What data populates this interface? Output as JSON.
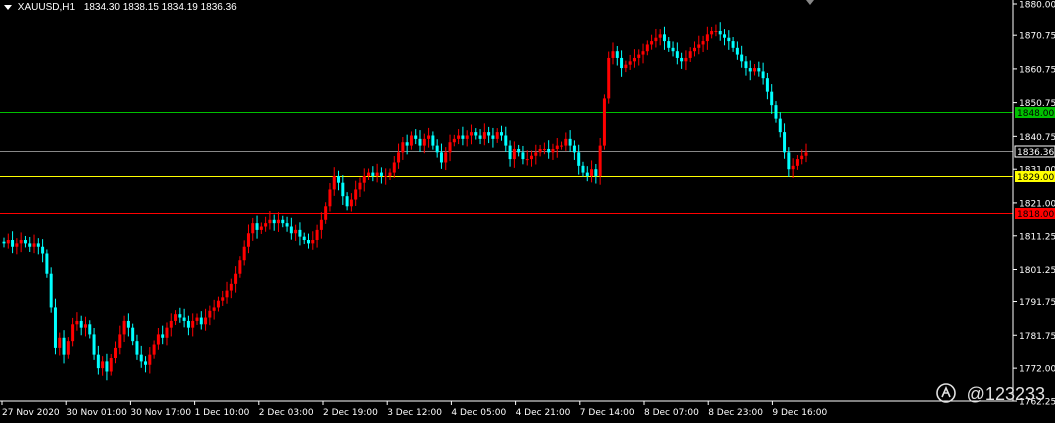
{
  "header": {
    "symbol": "XAUUSD,H1",
    "ohlc": "1834.30 1838.15 1834.19 1836.36"
  },
  "watermark": {
    "text": "@123233"
  },
  "colors": {
    "background": "#000000",
    "bull": "#ff0000",
    "bear": "#00ffff",
    "axis": "#ffffff",
    "grid_text": "#ffffff",
    "line_1848": "#00c000",
    "line_1829": "#ffff00",
    "line_1818": "#ff0000",
    "current_price": "#888888"
  },
  "chart_data": {
    "type": "candlestick",
    "ylim": [
      1762.25,
      1880.0
    ],
    "y_ticks": [
      "1880.00",
      "1870.75",
      "1860.75",
      "1850.75",
      "1840.75",
      "1831.00",
      "1821.00",
      "1811.25",
      "1801.25",
      "1791.75",
      "1781.75",
      "1772.00",
      "1762.25"
    ],
    "x_labels": [
      "27 Nov 2020",
      "30 Nov 01:00",
      "30 Nov 17:00",
      "1 Dec 10:00",
      "2 Dec 03:00",
      "2 Dec 19:00",
      "3 Dec 12:00",
      "4 Dec 05:00",
      "4 Dec 21:00",
      "7 Dec 14:00",
      "8 Dec 07:00",
      "8 Dec 23:00",
      "9 Dec 16:00"
    ],
    "current_price": {
      "value": 1836.36,
      "label": "1836.36"
    },
    "levels": [
      {
        "value": 1848.0,
        "label": "1848.00",
        "color": "#00c000"
      },
      {
        "value": 1829.0,
        "label": "1829.00",
        "color": "#ffff00"
      },
      {
        "value": 1818.0,
        "label": "1818.00",
        "color": "#ff0000"
      }
    ],
    "closes": [
      1809,
      1810,
      1808,
      1809,
      1810,
      1809,
      1808,
      1809,
      1808,
      1806,
      1800,
      1790,
      1778,
      1781,
      1776,
      1780,
      1785,
      1786,
      1784,
      1785,
      1782,
      1776,
      1772,
      1774,
      1771,
      1775,
      1778,
      1782,
      1786,
      1784,
      1780,
      1776,
      1774,
      1773,
      1776,
      1779,
      1782,
      1781,
      1784,
      1786,
      1788,
      1787,
      1786,
      1784,
      1786,
      1787,
      1785,
      1787,
      1789,
      1790,
      1792,
      1793,
      1795,
      1797,
      1800,
      1804,
      1808,
      1812,
      1815,
      1813,
      1814,
      1815,
      1816,
      1815,
      1816,
      1815,
      1814,
      1812,
      1813,
      1811,
      1810,
      1809,
      1810,
      1813,
      1816,
      1820,
      1825,
      1829,
      1827,
      1823,
      1820,
      1822,
      1825,
      1827,
      1829,
      1830,
      1829,
      1830,
      1829,
      1829,
      1830,
      1833,
      1836,
      1839,
      1838,
      1841,
      1840,
      1838,
      1840,
      1841,
      1838,
      1836,
      1833,
      1836,
      1839,
      1840,
      1841,
      1840,
      1841,
      1842,
      1841,
      1840,
      1842,
      1841,
      1840,
      1842,
      1841,
      1838,
      1834,
      1837,
      1836,
      1834,
      1834,
      1835,
      1836,
      1837,
      1837,
      1836,
      1837,
      1838,
      1838,
      1840,
      1838,
      1836,
      1832,
      1830,
      1829,
      1831,
      1829,
      1838,
      1852,
      1864,
      1866,
      1864,
      1861,
      1862,
      1863,
      1864,
      1865,
      1866,
      1868,
      1869,
      1870,
      1871,
      1869,
      1867,
      1866,
      1864,
      1863,
      1864,
      1866,
      1867,
      1868,
      1869,
      1871,
      1872,
      1872,
      1871,
      1870,
      1869,
      1867,
      1865,
      1863,
      1861,
      1860,
      1861,
      1860,
      1858,
      1854,
      1850,
      1846,
      1842,
      1836,
      1831,
      1832,
      1834,
      1835,
      1836
    ]
  }
}
